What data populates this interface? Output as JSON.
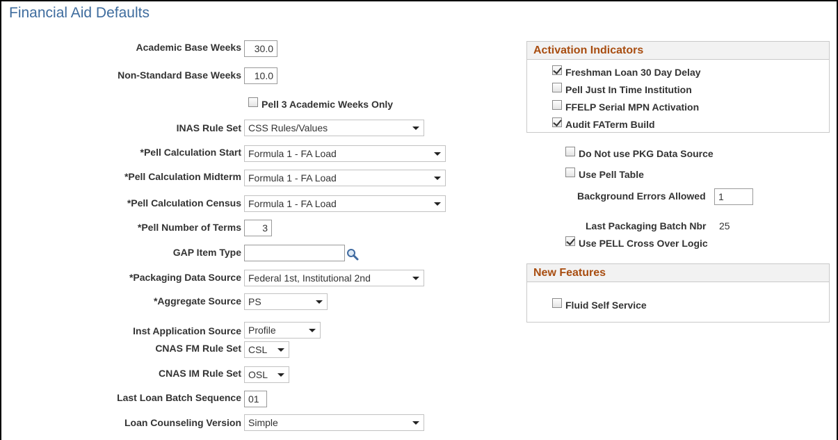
{
  "page": {
    "title": "Financial Aid Defaults"
  },
  "fields": {
    "academic_base_weeks": {
      "label": "Academic Base Weeks",
      "value": "30.0"
    },
    "non_standard_base_weeks": {
      "label": "Non-Standard Base Weeks",
      "value": "10.0"
    },
    "pell_3_academic_weeks": {
      "label": "Pell 3 Academic Weeks Only",
      "checked": false
    },
    "inas_rule_set": {
      "label": "INAS Rule Set",
      "value": "CSS Rules/Values"
    },
    "pell_calc_start": {
      "label": "*Pell Calculation Start",
      "value": "Formula 1 - FA Load"
    },
    "pell_calc_midterm": {
      "label": "*Pell Calculation Midterm",
      "value": "Formula 1 - FA Load"
    },
    "pell_calc_census": {
      "label": "*Pell Calculation Census",
      "value": "Formula 1 - FA Load"
    },
    "pell_number_of_terms": {
      "label": "*Pell Number of Terms",
      "value": "3"
    },
    "gap_item_type": {
      "label": "GAP Item Type",
      "value": ""
    },
    "packaging_data_source": {
      "label": "*Packaging Data Source",
      "value": "Federal 1st, Institutional 2nd"
    },
    "aggregate_source": {
      "label": "*Aggregate Source",
      "value": "PS"
    },
    "inst_application_source": {
      "label": "Inst Application Source",
      "value": "Profile"
    },
    "cnas_fm_rule_set": {
      "label": "CNAS FM Rule Set",
      "value": "CSL"
    },
    "cnas_im_rule_set": {
      "label": "CNAS IM Rule Set",
      "value": "OSL"
    },
    "last_loan_batch_sequence": {
      "label": "Last Loan Batch Sequence",
      "value": "01"
    },
    "loan_counseling_version": {
      "label": "Loan Counseling Version",
      "value": "Simple"
    }
  },
  "activation": {
    "title": "Activation Indicators",
    "items": [
      {
        "label": "Freshman Loan 30 Day Delay",
        "checked": true
      },
      {
        "label": "Pell Just In Time Institution",
        "checked": false
      },
      {
        "label": "FFELP Serial MPN Activation",
        "checked": false
      },
      {
        "label": "Audit FATerm Build",
        "checked": true
      }
    ]
  },
  "right": {
    "do_not_use_pkg": {
      "label": "Do Not use PKG Data Source",
      "checked": false
    },
    "use_pell_table": {
      "label": "Use Pell Table",
      "checked": false
    },
    "background_errors": {
      "label": "Background Errors Allowed",
      "value": "1"
    },
    "last_packaging_batch": {
      "label": "Last Packaging Batch Nbr",
      "value": "25"
    },
    "use_pell_cross_over": {
      "label": "Use PELL Cross Over Logic",
      "checked": true
    }
  },
  "new_features": {
    "title": "New Features",
    "items": [
      {
        "label": "Fluid Self Service",
        "checked": false
      }
    ]
  },
  "colors": {
    "title": "#3e6c9e",
    "group_title": "#a84d10",
    "group_header_bg": "#f2f2f2"
  },
  "icons": {
    "lookup": "magnifier-icon",
    "dropdown": "chevron-down-icon"
  }
}
